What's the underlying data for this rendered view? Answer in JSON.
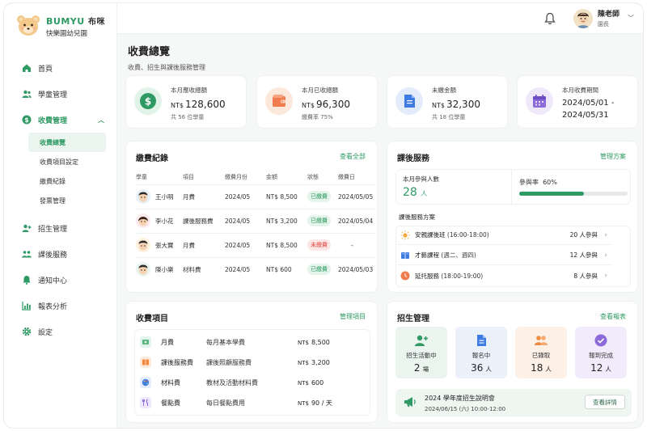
{
  "brand": {
    "name": "BUMYU",
    "name_zh": "布咪",
    "subtitle": "快樂園幼兒園"
  },
  "sidebar": {
    "items": [
      {
        "label": "首頁",
        "icon": "home-icon"
      },
      {
        "label": "學童管理",
        "icon": "users-icon"
      },
      {
        "label": "收費管理",
        "icon": "dollar-icon",
        "active": true
      },
      {
        "label": "招生管理",
        "icon": "add-user-icon"
      },
      {
        "label": "課後服務",
        "icon": "group-icon"
      },
      {
        "label": "通知中心",
        "icon": "bell-icon"
      },
      {
        "label": "報表分析",
        "icon": "bar-chart-icon"
      },
      {
        "label": "設定",
        "icon": "gear-icon"
      }
    ],
    "sub_items": [
      "收費總覽",
      "收費項目設定",
      "繳費紀錄",
      "發票管理"
    ]
  },
  "topbar": {
    "user_name": "陳老師",
    "user_role": "園長"
  },
  "page": {
    "title": "收費總覽",
    "subtitle": "收費、招生與課後服務管理"
  },
  "stats": [
    {
      "label": "本月應收總額",
      "currency": "NT$",
      "value": "128,600",
      "foot": "共 56 位學童"
    },
    {
      "label": "本月已收總額",
      "currency": "NT$",
      "value": "96,300",
      "foot": "繳費率 75%"
    },
    {
      "label": "未繳金額",
      "currency": "NT$",
      "value": "32,300",
      "foot": "共 18 位學童"
    },
    {
      "label": "本月收費期間",
      "value": "2024/05/01 -",
      "value2": "2024/05/31"
    }
  ],
  "payments": {
    "title": "繳費紀錄",
    "link": "查看全部",
    "columns": [
      "學童",
      "項目",
      "繳費月份",
      "金額",
      "狀態",
      "繳費日"
    ],
    "rows": [
      {
        "name": "王小明",
        "item": "月費",
        "month": "2024/05",
        "amount": "NT$ 8,500",
        "status": "已繳費",
        "date": "2024/05/05"
      },
      {
        "name": "李小花",
        "item": "課後服務費",
        "month": "2024/05",
        "amount": "NT$ 3,200",
        "status": "已繳費",
        "date": "2024/05/04"
      },
      {
        "name": "張大寶",
        "item": "月費",
        "month": "2024/05",
        "amount": "NT$ 8,500",
        "status": "未繳費",
        "date": "-"
      },
      {
        "name": "陳小樂",
        "item": "材料費",
        "month": "2024/05",
        "amount": "NT$ 600",
        "status": "已繳費",
        "date": "2024/05/03"
      }
    ]
  },
  "after_school": {
    "title": "課後服務",
    "link": "管理方案",
    "enrolled_label": "本月參與人數",
    "enrolled_value": "28",
    "enrolled_unit": "人",
    "rate_label": "參與率",
    "rate_value": "60%",
    "rate_fraction": 0.6,
    "plans_title": "課後服務方案",
    "plans": [
      {
        "name": "安親課後班",
        "time": "(16:00-18:00)",
        "count": "20 人參與"
      },
      {
        "name": "才藝課程",
        "time": "(週二、週四)",
        "count": "12 人參與"
      },
      {
        "name": "延托服務",
        "time": "(18:00-19:00)",
        "count": "8 人參與"
      }
    ]
  },
  "fees": {
    "title": "收費項目",
    "link": "管理項目",
    "items": [
      {
        "name": "月費",
        "desc": "每月基本學費",
        "currency": "NT$",
        "amount": "8,500"
      },
      {
        "name": "課後服務費",
        "desc": "課後照顧服務費",
        "currency": "NT$",
        "amount": "3,200"
      },
      {
        "name": "材料費",
        "desc": "教材及活動材料費",
        "currency": "NT$",
        "amount": "600"
      },
      {
        "name": "餐點費",
        "desc": "每日餐點費用",
        "currency": "NT$",
        "amount": "90 / 天"
      }
    ]
  },
  "enrollment": {
    "title": "招生管理",
    "link": "查看報表",
    "stats": [
      {
        "label": "招生活動中",
        "value": "2",
        "unit": "場"
      },
      {
        "label": "報名中",
        "value": "36",
        "unit": "人"
      },
      {
        "label": "已錄取",
        "value": "18",
        "unit": "人"
      },
      {
        "label": "報到完成",
        "value": "12",
        "unit": "人"
      }
    ],
    "event_title": "2024 學年度招生說明會",
    "event_time": "2024/06/15 (六) 10:00-12:00",
    "event_button": "查看詳情"
  },
  "colors": {
    "accent": "#2f9a63",
    "danger": "#e24b43",
    "accent_light": "#eaf5ef"
  }
}
